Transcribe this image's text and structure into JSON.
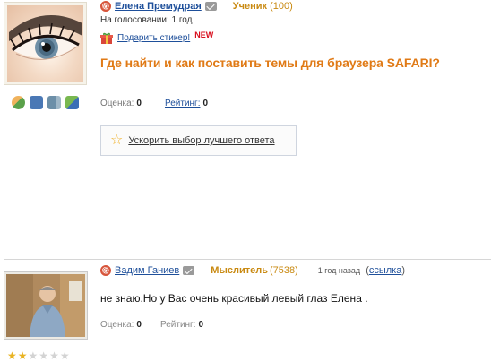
{
  "question": {
    "author_name": "Елена Премудрая",
    "rank": "Ученик",
    "rank_points": "(100)",
    "voting_status": "На голосовании: 1 год",
    "gift_link": "Подарить стикер!",
    "new_badge": "NEW",
    "title": "Где найти и как поставить темы для браузера SAFARI?",
    "score_label": "Оценка:",
    "score_value": "0",
    "rating_label": "Рейтинг:",
    "rating_value": "0",
    "speed_button": "Ускорить выбор лучшего ответа",
    "profile_icons": [
      "friends-icon",
      "camera-icon",
      "video-icon",
      "edit-icon"
    ]
  },
  "answer": {
    "author_name": "Вадим Ганиев",
    "rank": "Мыслитель",
    "rank_points": "(7538)",
    "time": "1 год назад",
    "link_open": "(",
    "link": "ссылка",
    "link_close": ")",
    "text": "не знаю.Но у Вас очень красивый левый глаз Елена .",
    "score_label": "Оценка:",
    "score_value": "0",
    "rating_label": "Рейтинг:",
    "rating_value": "0",
    "stars": {
      "filled": 2,
      "total": 6
    }
  },
  "colors": {
    "link": "#1e4f9a",
    "rank": "#c98a12",
    "title": "#e07a16",
    "new_badge": "#d8101f",
    "star": "#e9b322"
  }
}
